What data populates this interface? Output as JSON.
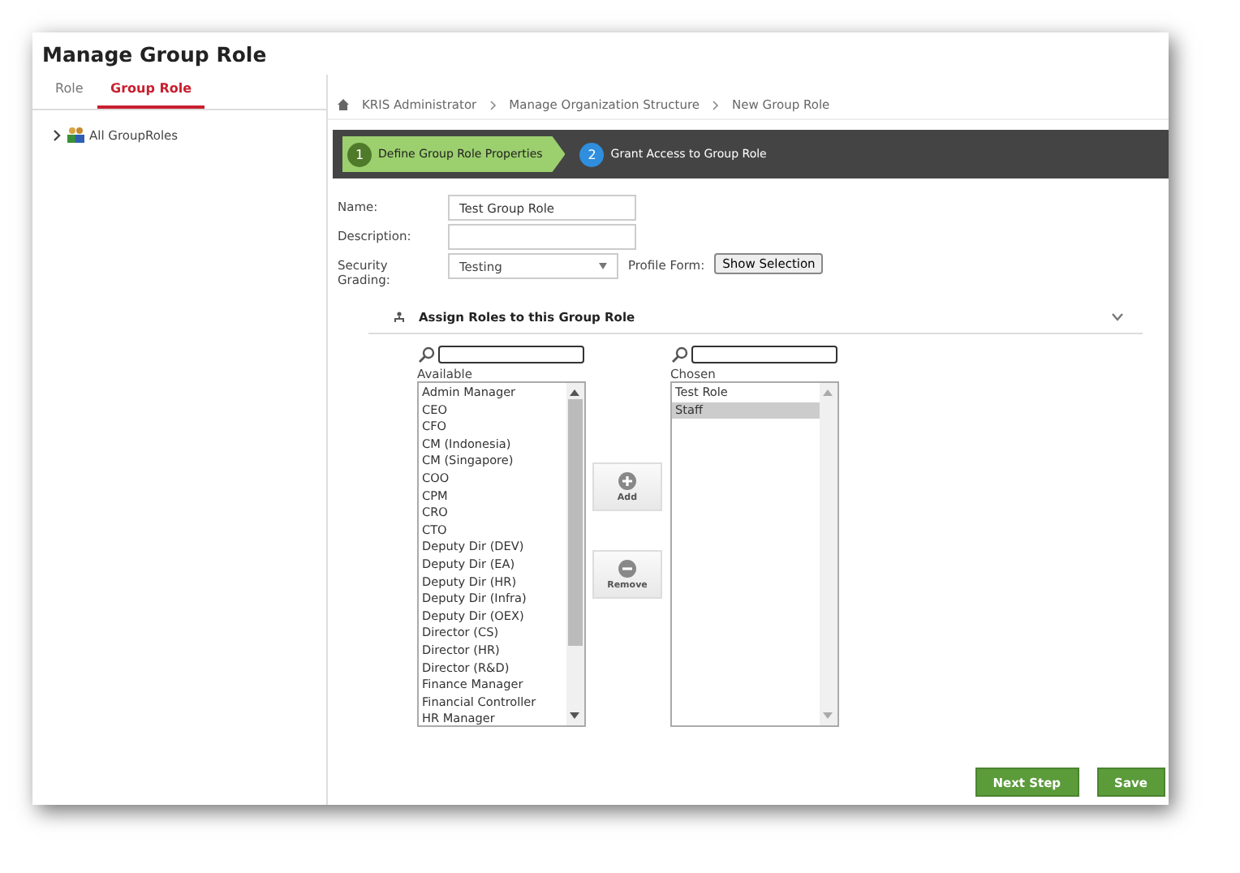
{
  "title": "Manage Group Role",
  "tabs": [
    {
      "label": "Role",
      "selected": false
    },
    {
      "label": "Group Role",
      "selected": true
    }
  ],
  "tree": [
    {
      "label": "All GroupRoles",
      "expanded": false
    }
  ],
  "breadcrumb": [
    "KRIS Administrator",
    "Manage Organization Structure",
    "New Group Role"
  ],
  "steps": [
    {
      "number": "1",
      "label": "Define Group Role Properties",
      "selected": true
    },
    {
      "number": "2",
      "label": "Grant Access to Group Role",
      "selected": false
    }
  ],
  "form": {
    "name_label": "Name:",
    "name_value": "Test Group Role",
    "description_label": "Description:",
    "grading_label": "Security Grading:",
    "grading_value": "Testing",
    "profile_label": "Profile Form:",
    "profile_button": "Show Selection"
  },
  "assign": {
    "heading": "Assign Roles to this Group Role",
    "expanded": true,
    "available_label": "Available",
    "chosen_label": "Chosen",
    "available": [
      {
        "label": "Admin Manager",
        "selected": false
      },
      {
        "label": "CEO",
        "selected": false
      },
      {
        "label": "CFO",
        "selected": false
      },
      {
        "label": "CM (Indonesia)",
        "selected": false
      },
      {
        "label": "CM (Singapore)",
        "selected": false
      },
      {
        "label": "COO",
        "selected": false
      },
      {
        "label": "CPM",
        "selected": false
      },
      {
        "label": "CRO",
        "selected": false
      },
      {
        "label": "CTO",
        "selected": false
      },
      {
        "label": "Deputy Dir (DEV)",
        "selected": false
      },
      {
        "label": "Deputy Dir (EA)",
        "selected": false
      },
      {
        "label": "Deputy Dir (HR)",
        "selected": false
      },
      {
        "label": "Deputy Dir (Infra)",
        "selected": false
      },
      {
        "label": "Deputy Dir (OEX)",
        "selected": false
      },
      {
        "label": "Director (CS)",
        "selected": false
      },
      {
        "label": "Director (HR)",
        "selected": false
      },
      {
        "label": "Director (R&D)",
        "selected": false
      },
      {
        "label": "Finance Manager",
        "selected": false
      },
      {
        "label": "Financial Controller",
        "selected": false
      },
      {
        "label": "HR Manager",
        "selected": false
      }
    ],
    "chosen": [
      {
        "label": "Test Role",
        "selected": false
      },
      {
        "label": "Staff",
        "selected": true
      }
    ],
    "add_label": "Add",
    "remove_label": "Remove"
  },
  "buttons": [
    "Next Step",
    "Save"
  ]
}
